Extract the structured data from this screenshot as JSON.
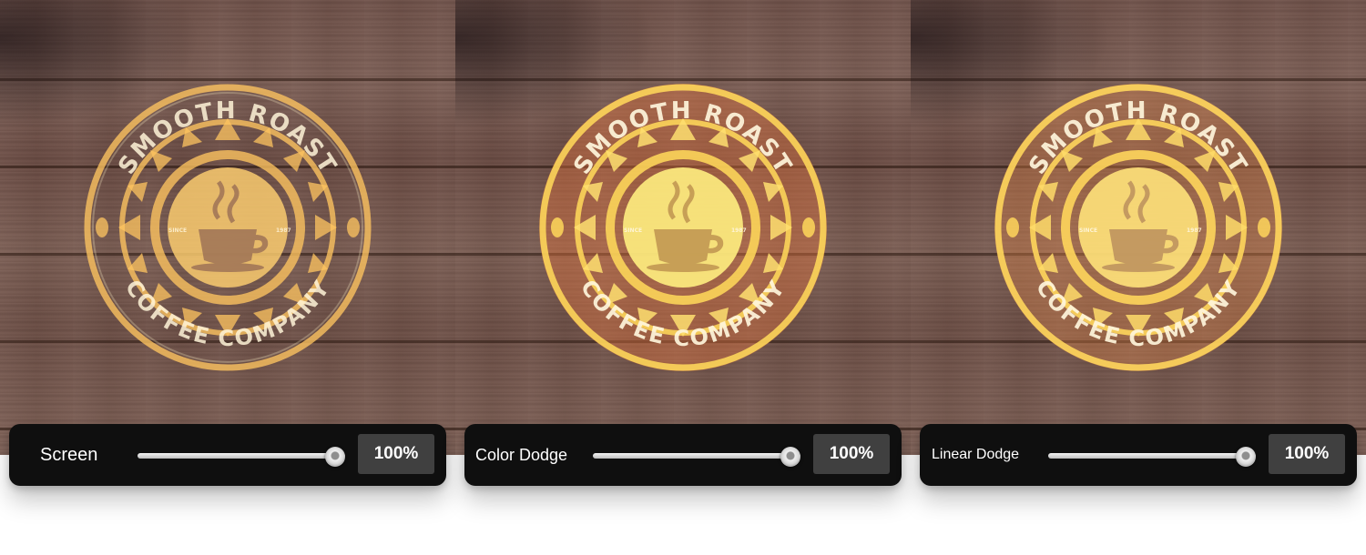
{
  "panels": [
    {
      "mode": "Screen",
      "opacity_label": "100%",
      "opacity_value": 1.0,
      "tint": "#ffc560",
      "seal": {
        "top_text": "SMOOTH ROAST",
        "bottom_text": "COFFEE COMPANY",
        "since_label": "SINCE",
        "year_label": "1987"
      }
    },
    {
      "mode": "Color Dodge",
      "opacity_label": "100%",
      "opacity_value": 1.0,
      "tint": "#ffd85a",
      "seal": {
        "top_text": "SMOOTH ROAST",
        "bottom_text": "COFFEE COMPANY",
        "since_label": "SINCE",
        "year_label": "1987"
      }
    },
    {
      "mode": "Linear Dodge",
      "opacity_label": "100%",
      "opacity_value": 1.0,
      "tint": "#ffd65c",
      "seal": {
        "top_text": "SMOOTH ROAST",
        "bottom_text": "COFFEE COMPANY",
        "since_label": "SINCE",
        "year_label": "1987"
      }
    }
  ]
}
